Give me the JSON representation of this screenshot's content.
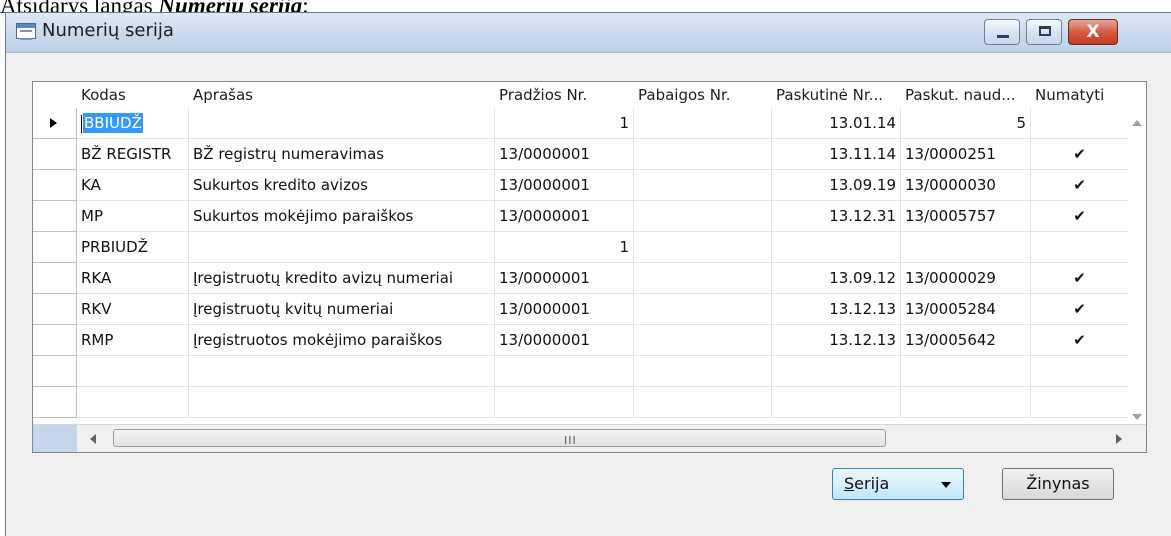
{
  "caption": {
    "prefix": "Atsidarys langas ",
    "emphasis": "Numerių serija",
    "suffix": ":"
  },
  "window": {
    "title": "Numerių serija",
    "minimize_icon": "minimize-icon",
    "maximize_icon": "maximize-icon",
    "close_label": "X"
  },
  "table": {
    "columns": [
      "Kodas",
      "Aprašas",
      "Pradžios Nr.",
      "Pabaigos Nr.",
      "Paskutinė Nr...",
      "Paskut. naud...",
      "Numatyti"
    ],
    "rows": [
      [
        "BBIUDŽ",
        "",
        "1",
        "",
        "13.01.14",
        "5",
        ""
      ],
      [
        "BŽ REGISTR",
        "BŽ registrų numeravimas",
        "13/0000001",
        "",
        "13.11.14",
        "13/0000251",
        "✔"
      ],
      [
        "KA",
        "Sukurtos kredito avizos",
        "13/0000001",
        "",
        "13.09.19",
        "13/0000030",
        "✔"
      ],
      [
        "MP",
        "Sukurtos mokėjimo paraiškos",
        "13/0000001",
        "",
        "13.12.31",
        "13/0005757",
        "✔"
      ],
      [
        "PRBIUDŽ",
        "",
        "1",
        "",
        "",
        "",
        ""
      ],
      [
        "RKA",
        "Įregistruotų kredito avizų numeriai",
        "13/0000001",
        "",
        "13.09.12",
        "13/0000029",
        "✔"
      ],
      [
        "RKV",
        "Įregistruotų kvitų numeriai",
        "13/0000001",
        "",
        "13.12.13",
        "13/0005284",
        "✔"
      ],
      [
        "RMP",
        "Įregistruotos mokėjimo paraiškos",
        "13/0000001",
        "",
        "13.12.13",
        "13/0005642",
        "✔"
      ],
      [
        "",
        "",
        "",
        "",
        "",
        "",
        ""
      ],
      [
        "",
        "",
        "",
        "",
        "",
        "",
        ""
      ]
    ],
    "active_row": 0,
    "scroll_grip": "III"
  },
  "buttons": {
    "serija_mnemonic": "S",
    "serija_rest": "erija",
    "zinynas": "Žinynas"
  }
}
